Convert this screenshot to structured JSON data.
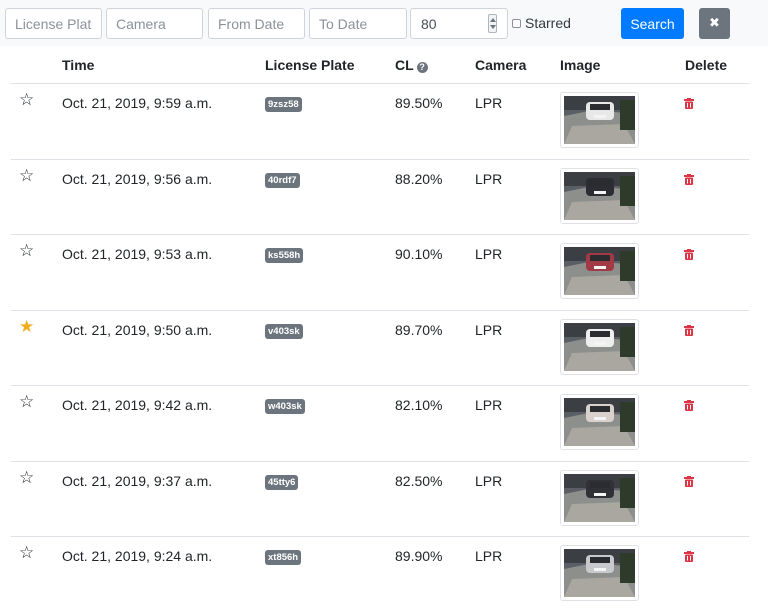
{
  "filters": {
    "plate_placeholder": "License Plate",
    "camera_placeholder": "Camera",
    "from_placeholder": "From Date",
    "to_placeholder": "To Date",
    "confidence_value": "80",
    "starred_label": "Starred",
    "search_label": "Search",
    "clear_icon": "x-icon"
  },
  "table": {
    "headers": {
      "time": "Time",
      "plate": "License Plate",
      "cl": "CL",
      "camera": "Camera",
      "image": "Image",
      "delete": "Delete"
    },
    "rows": [
      {
        "starred": false,
        "time": "Oct. 21, 2019, 9:59 a.m.",
        "plate": "9zsz58",
        "cl": "89.50%",
        "camera": "LPR",
        "car": "#e8e8e8"
      },
      {
        "starred": false,
        "time": "Oct. 21, 2019, 9:56 a.m.",
        "plate": "40rdf7",
        "cl": "88.20%",
        "camera": "LPR",
        "car": "#2b2d33"
      },
      {
        "starred": false,
        "time": "Oct. 21, 2019, 9:53 a.m.",
        "plate": "ks558h",
        "cl": "90.10%",
        "camera": "LPR",
        "car": "#a23a45"
      },
      {
        "starred": true,
        "time": "Oct. 21, 2019, 9:50 a.m.",
        "plate": "v403sk",
        "cl": "89.70%",
        "camera": "LPR",
        "car": "#eeeeee"
      },
      {
        "starred": false,
        "time": "Oct. 21, 2019, 9:42 a.m.",
        "plate": "w403sk",
        "cl": "82.10%",
        "camera": "LPR",
        "car": "#d9d2cc"
      },
      {
        "starred": false,
        "time": "Oct. 21, 2019, 9:37 a.m.",
        "plate": "45tty6",
        "cl": "82.50%",
        "camera": "LPR",
        "car": "#303136"
      },
      {
        "starred": false,
        "time": "Oct. 21, 2019, 9:24 a.m.",
        "plate": "xt856h",
        "cl": "89.90%",
        "camera": "LPR",
        "car": "#c7c9cc"
      }
    ]
  },
  "icons": {
    "star_empty": "star-outline-icon",
    "star_filled": "star-filled-icon",
    "help": "question-circle-icon",
    "delete": "trash-icon"
  },
  "colors": {
    "primary": "#007bff",
    "secondary": "#6c757d",
    "danger": "#dc3545",
    "star": "#f0ad1f"
  }
}
